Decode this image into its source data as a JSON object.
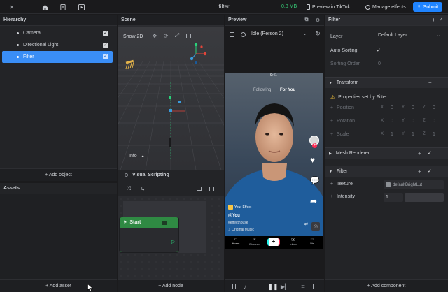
{
  "topbar": {
    "title": "filter",
    "size": "0.3 MB",
    "preview_label": "Preview in TikTok",
    "manage_label": "Manage effects",
    "submit_label": "Submit",
    "accent": "#1f84ff",
    "size_color": "#37d07a"
  },
  "hierarchy": {
    "title": "Hierarchy",
    "items": [
      {
        "label": "Camera"
      },
      {
        "label": "Directional Light"
      },
      {
        "label": "Filter"
      }
    ],
    "add_label": "+ Add object"
  },
  "assets": {
    "title": "Assets",
    "add_label": "+ Add asset"
  },
  "scene": {
    "title": "Scene",
    "show2d_label": "Show 2D",
    "info_label": "Info",
    "info_arrow": "▲"
  },
  "visual_scripting": {
    "title": "Visual Scripting",
    "start_label": "Start",
    "add_node_label": "+ Add node"
  },
  "preview": {
    "title": "Preview",
    "mode_label": "Idle (Person 2)",
    "phone": {
      "time": "9:41",
      "following": "Following",
      "for_you": "For You",
      "your_effect": "Your Effect",
      "username": "@You",
      "hashtag": "#effecthouse",
      "music": "Original Music",
      "nav": [
        "Home",
        "Discover",
        "+",
        "Inbox",
        "Me"
      ]
    }
  },
  "inspector": {
    "title": "Filter",
    "layer_label": "Layer",
    "layer_value": "Default Layer",
    "auto_sorting_label": "Auto Sorting",
    "sorting_order_label": "Sorting Order",
    "sorting_order_value": "0",
    "transform": {
      "title": "Transform",
      "warning": "Properties set by Filter",
      "position_label": "Position",
      "rotation_label": "Rotation",
      "scale_label": "Scale",
      "axis_x": "X",
      "axis_y": "Y",
      "axis_z": "Z",
      "pos": [
        "0",
        "0",
        "0"
      ],
      "rot": [
        "0",
        "0",
        "0"
      ],
      "scl": [
        "1",
        "1",
        "1"
      ]
    },
    "mesh_renderer": {
      "title": "Mesh Renderer"
    },
    "filter": {
      "title": "Filter",
      "texture_label": "Texture",
      "texture_value": "defaultBrightLut",
      "intensity_label": "Intensity",
      "intensity_value": "1"
    },
    "add_component_label": "+ Add component"
  }
}
